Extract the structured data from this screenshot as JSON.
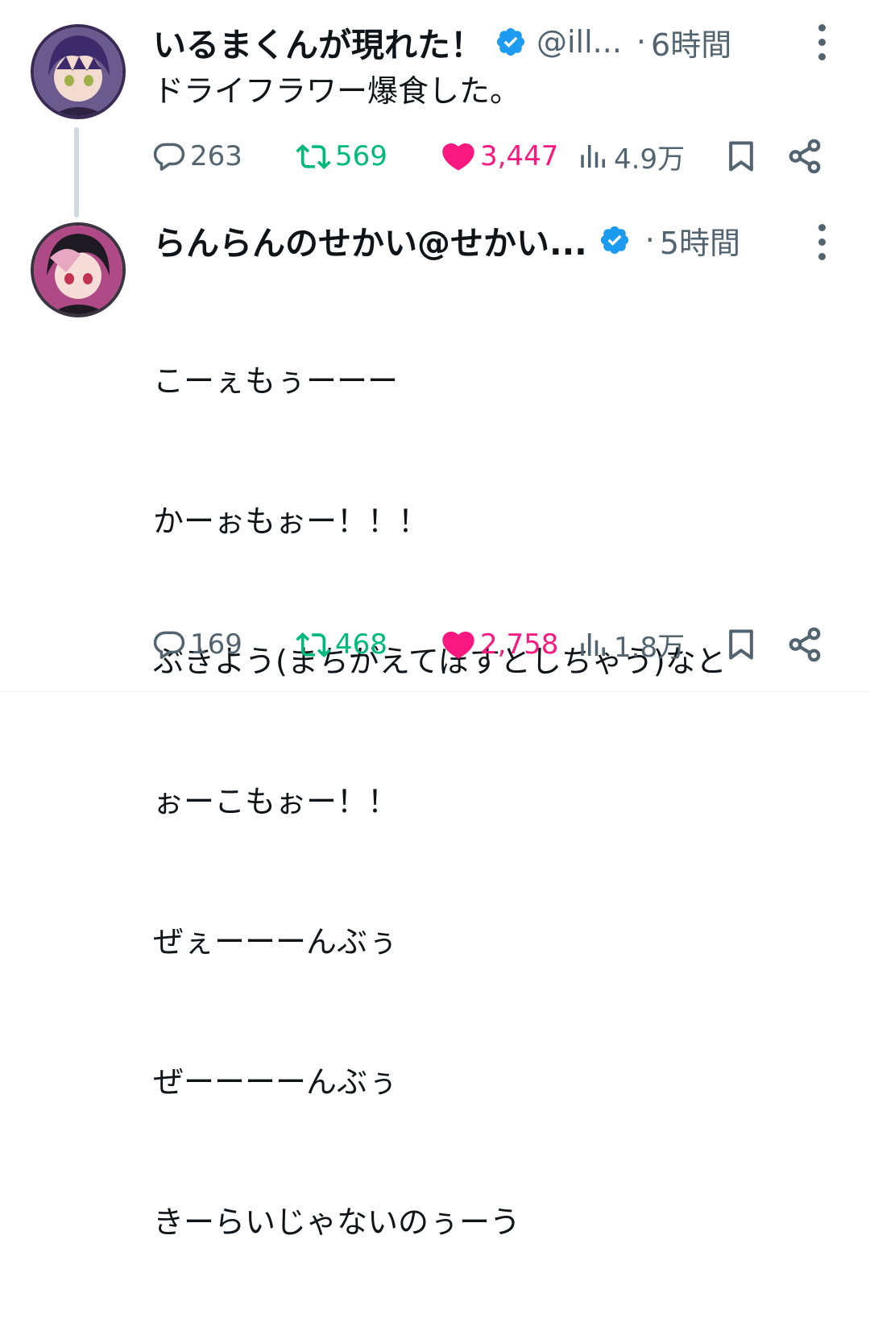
{
  "tweets": [
    {
      "name": "いるまくんが現れた！",
      "handle": "@ill...",
      "dot": "·",
      "time": "6時間",
      "text": "ドライフラワー爆食した。",
      "replies": "263",
      "retweets": "569",
      "likes": "3,447",
      "views": "4.9万"
    },
    {
      "name": "らんらんのせかい@せかい...",
      "dot": "·",
      "time": "5時間",
      "lines": [
        "こーぇもぅーーー",
        "かーぉもぉー！！！",
        "ぶきよう(まちがえてぽすとしちゃう)なと",
        "ぉーこもぉー！！",
        "ぜぇーーーんぶぅ",
        "ぜーーーーんぶぅ",
        "きーらいじゃないのぅーう"
      ],
      "replies": "169",
      "retweets": "468",
      "likes": "2,758",
      "views": "1.8万"
    }
  ],
  "colors": {
    "verified": "#1d9bf0",
    "retweet": "#00ba7c",
    "like": "#f91880",
    "muted": "#536471"
  },
  "icons": [
    "reply-icon",
    "retweet-icon",
    "like-icon",
    "views-icon",
    "bookmark-icon",
    "share-icon",
    "more-icon",
    "verified-icon"
  ]
}
